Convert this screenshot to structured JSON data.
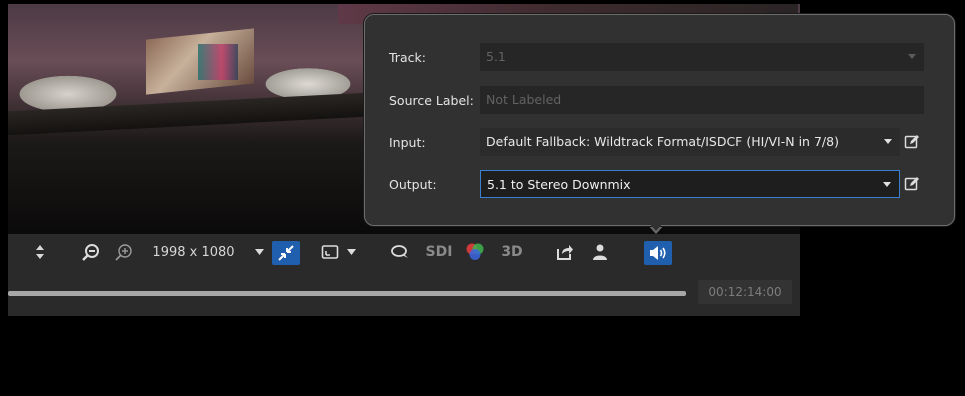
{
  "popup": {
    "track": {
      "label": "Track:",
      "value": "5.1"
    },
    "source_label": {
      "label": "Source Label:",
      "placeholder": "Not Labeled"
    },
    "input": {
      "label": "Input:",
      "value": "Default Fallback: Wildtrack Format/ISDCF (HI/VI-N in 7/8)"
    },
    "output": {
      "label": "Output:",
      "value": "5.1 to Stereo Downmix"
    }
  },
  "toolbar": {
    "resolution": "1998 x 1080",
    "sdi_label": "SDI",
    "three_d_label": "3D",
    "icons": [
      "up-down-arrows-icon",
      "zoom-out-icon",
      "zoom-in-icon",
      "fit-to-window-icon",
      "aspect-ratio-icon",
      "subtitles-icon",
      "color-channels-icon",
      "export-icon",
      "user-icon",
      "audio-icon"
    ],
    "accent_color": "#1f5fae"
  },
  "timeline": {
    "timecode": "00:12:14:00"
  }
}
